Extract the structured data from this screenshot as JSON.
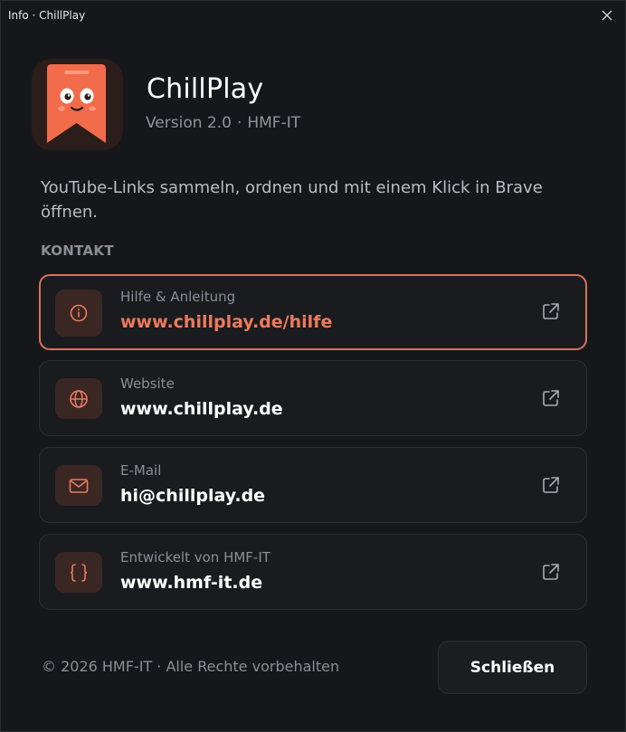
{
  "window": {
    "title": "Info · ChillPlay"
  },
  "app": {
    "name": "ChillPlay",
    "version": "Version 2.0",
    "separator": "·",
    "vendor": "HMF-IT",
    "description": "YouTube-Links sammeln, ordnen und mit einem Klick in Brave öffnen."
  },
  "contact": {
    "heading": "KONTAKT",
    "items": [
      {
        "label": "Hilfe & Anleitung",
        "value": "www.chillplay.de/hilfe",
        "icon": "info-icon",
        "active": true
      },
      {
        "label": "Website",
        "value": "www.chillplay.de",
        "icon": "globe-icon",
        "active": false
      },
      {
        "label": "E-Mail",
        "value": "hi@chillplay.de",
        "icon": "mail-icon",
        "active": false
      },
      {
        "label": "Entwickelt von HMF-IT",
        "value": "www.hmf-it.de",
        "icon": "code-braces-icon",
        "active": false
      }
    ]
  },
  "footer": {
    "copyright": "© 2026 HMF-IT · Alle Rechte vorbehalten",
    "close_label": "Schließen"
  },
  "colors": {
    "background": "#16171b",
    "card": "#1a1b1f",
    "accent": "#ec7a5c",
    "icon_bg": "#3a2723",
    "logo_orange": "#f26b4b"
  }
}
